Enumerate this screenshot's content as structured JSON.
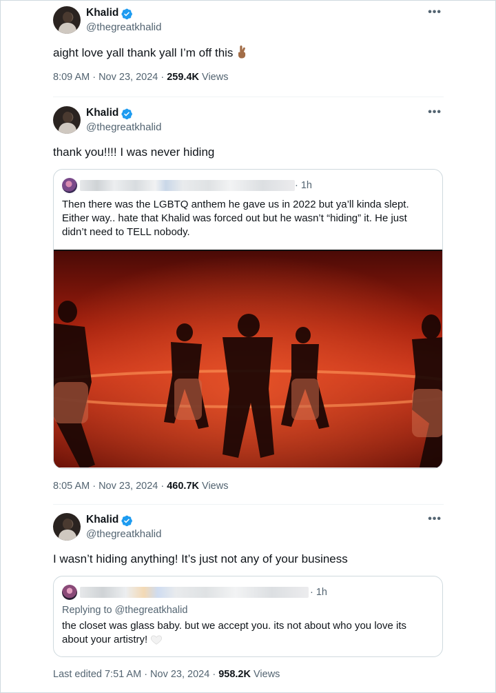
{
  "tweets": [
    {
      "name": "Khalid",
      "handle": "@thegreatkhalid",
      "more": "•••",
      "text": "aight love yall thank yall I’m off this",
      "emoji": "crossed-fingers-emoji",
      "time": "8:09 AM · Nov 23, 2024 · ",
      "views_count": "259.4K",
      "views_label": " Views"
    },
    {
      "name": "Khalid",
      "handle": "@thegreatkhalid",
      "more": "•••",
      "text": "thank you!!!! I was never hiding",
      "quote": {
        "time": "· 1h",
        "text": "Then there was the LGBTQ anthem he gave us in 2022 but ya’ll kinda slept. Either way.. hate that Khalid was forced out but he wasn’t “hiding” it. He just didn’t need to TELL nobody.",
        "media": "red-lit-dance-video-still"
      },
      "time": "8:05 AM · Nov 23, 2024 · ",
      "views_count": "460.7K",
      "views_label": " Views"
    },
    {
      "name": "Khalid",
      "handle": "@thegreatkhalid",
      "more": "•••",
      "text": "I wasn’t hiding anything! It’s just not any of your business",
      "quote": {
        "time": "· 1h",
        "replying": "Replying to @thegreatkhalid",
        "text": "the closet was glass baby. but we accept you. its not about who you love its about your artistry!",
        "emoji": "white-heart-emoji"
      },
      "time": "Last edited 7:51 AM · Nov 23, 2024 · ",
      "views_count": "958.2K",
      "views_label": " Views"
    }
  ],
  "colors": {
    "text": "#0f1419",
    "secondary": "#536471",
    "verified": "#1d9bf0",
    "border": "#cfd9de",
    "media_red": "#c0270f"
  }
}
